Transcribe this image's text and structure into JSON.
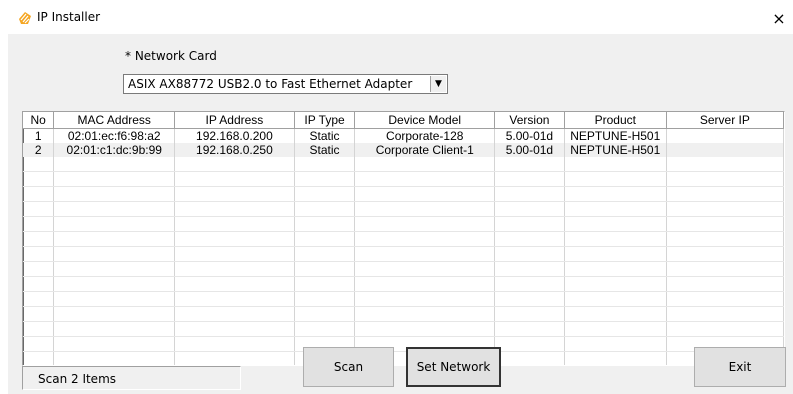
{
  "window": {
    "title": "IP Installer",
    "close_glyph": "×"
  },
  "network": {
    "label": "* Network Card",
    "selected": "ASIX AX88772 USB2.0 to Fast Ethernet Adapter"
  },
  "table": {
    "columns": [
      "No",
      "MAC Address",
      "IP Address",
      "IP Type",
      "Device Model",
      "Version",
      "Product",
      "Server IP"
    ],
    "rows": [
      [
        "1",
        "02:01:ec:f6:98:a2",
        "192.168.0.200",
        "Static",
        "Corporate-128",
        "5.00-01d",
        "NEPTUNE-H501",
        ""
      ],
      [
        "2",
        "02:01:c1:dc:9b:99",
        "192.168.0.250",
        "Static",
        "Corporate Client-1",
        "5.00-01d",
        "NEPTUNE-H501",
        ""
      ]
    ]
  },
  "status": {
    "text": "Scan 2 Items"
  },
  "buttons": {
    "scan": "Scan",
    "set_network": "Set Network",
    "exit": "Exit"
  },
  "colors": {
    "app_icon": "#f5a623",
    "selection_bg": "#f0f0f0",
    "default_button_border": "#0078d7"
  },
  "icons": {
    "app": "app-logo-icon",
    "close": "close-icon",
    "dropdown": "chevron-down-icon"
  }
}
